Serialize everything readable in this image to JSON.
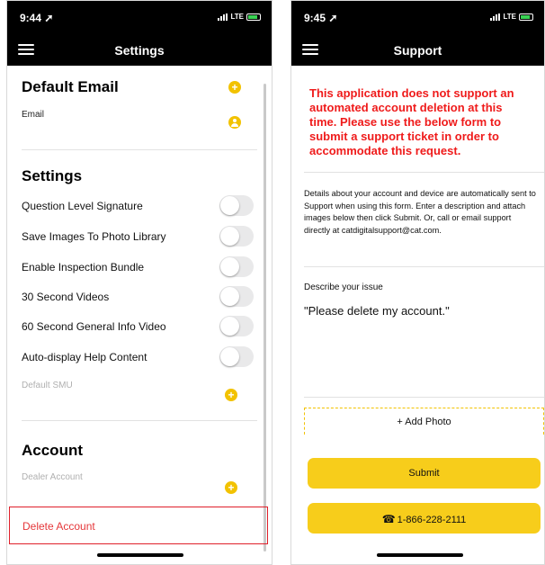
{
  "screen1": {
    "status": {
      "time": "9:44 ➚",
      "network": "LTE"
    },
    "title": "Settings",
    "default_email": {
      "heading": "Default Email",
      "email_label": "Email"
    },
    "settings": {
      "heading": "Settings",
      "toggles": [
        {
          "label": "Question Level Signature",
          "on": false
        },
        {
          "label": "Save Images To Photo Library",
          "on": false
        },
        {
          "label": "Enable Inspection Bundle",
          "on": false
        },
        {
          "label": "30 Second Videos",
          "on": false
        },
        {
          "label": "60 Second General Info Video",
          "on": false
        },
        {
          "label": "Auto-display Help Content",
          "on": false
        }
      ],
      "default_smu_label": "Default SMU"
    },
    "account": {
      "heading": "Account",
      "dealer_label": "Dealer Account",
      "delete_label": "Delete Account"
    }
  },
  "screen2": {
    "status": {
      "time": "9:45 ➚",
      "network": "LTE"
    },
    "title": "Support",
    "notice": "This application does not support an automated account deletion at this time. Please use the below form to submit a support ticket in order to accommodate this request.",
    "info": "Details about your account and device are automatically sent to Support when using this form.  Enter a description and attach images below then click Submit.  Or, call or email support directly at catdigitalsupport@cat.com.",
    "describe_label": "Describe your issue",
    "issue_text": "\"Please delete my account.\"",
    "add_photo_label": "+ Add Photo",
    "submit_label": "Submit",
    "phone_label": "1-866-228-2111"
  },
  "icons": {
    "menu": "hamburger-icon",
    "add": "plus-circle-icon",
    "user": "user-circle-icon",
    "phone": "phone-icon"
  },
  "colors": {
    "accent_yellow": "#f7cd1b",
    "icon_yellow": "#f2c200",
    "danger_red": "#e5373a",
    "notice_red": "#ef1b1b",
    "header_black": "#000000"
  }
}
